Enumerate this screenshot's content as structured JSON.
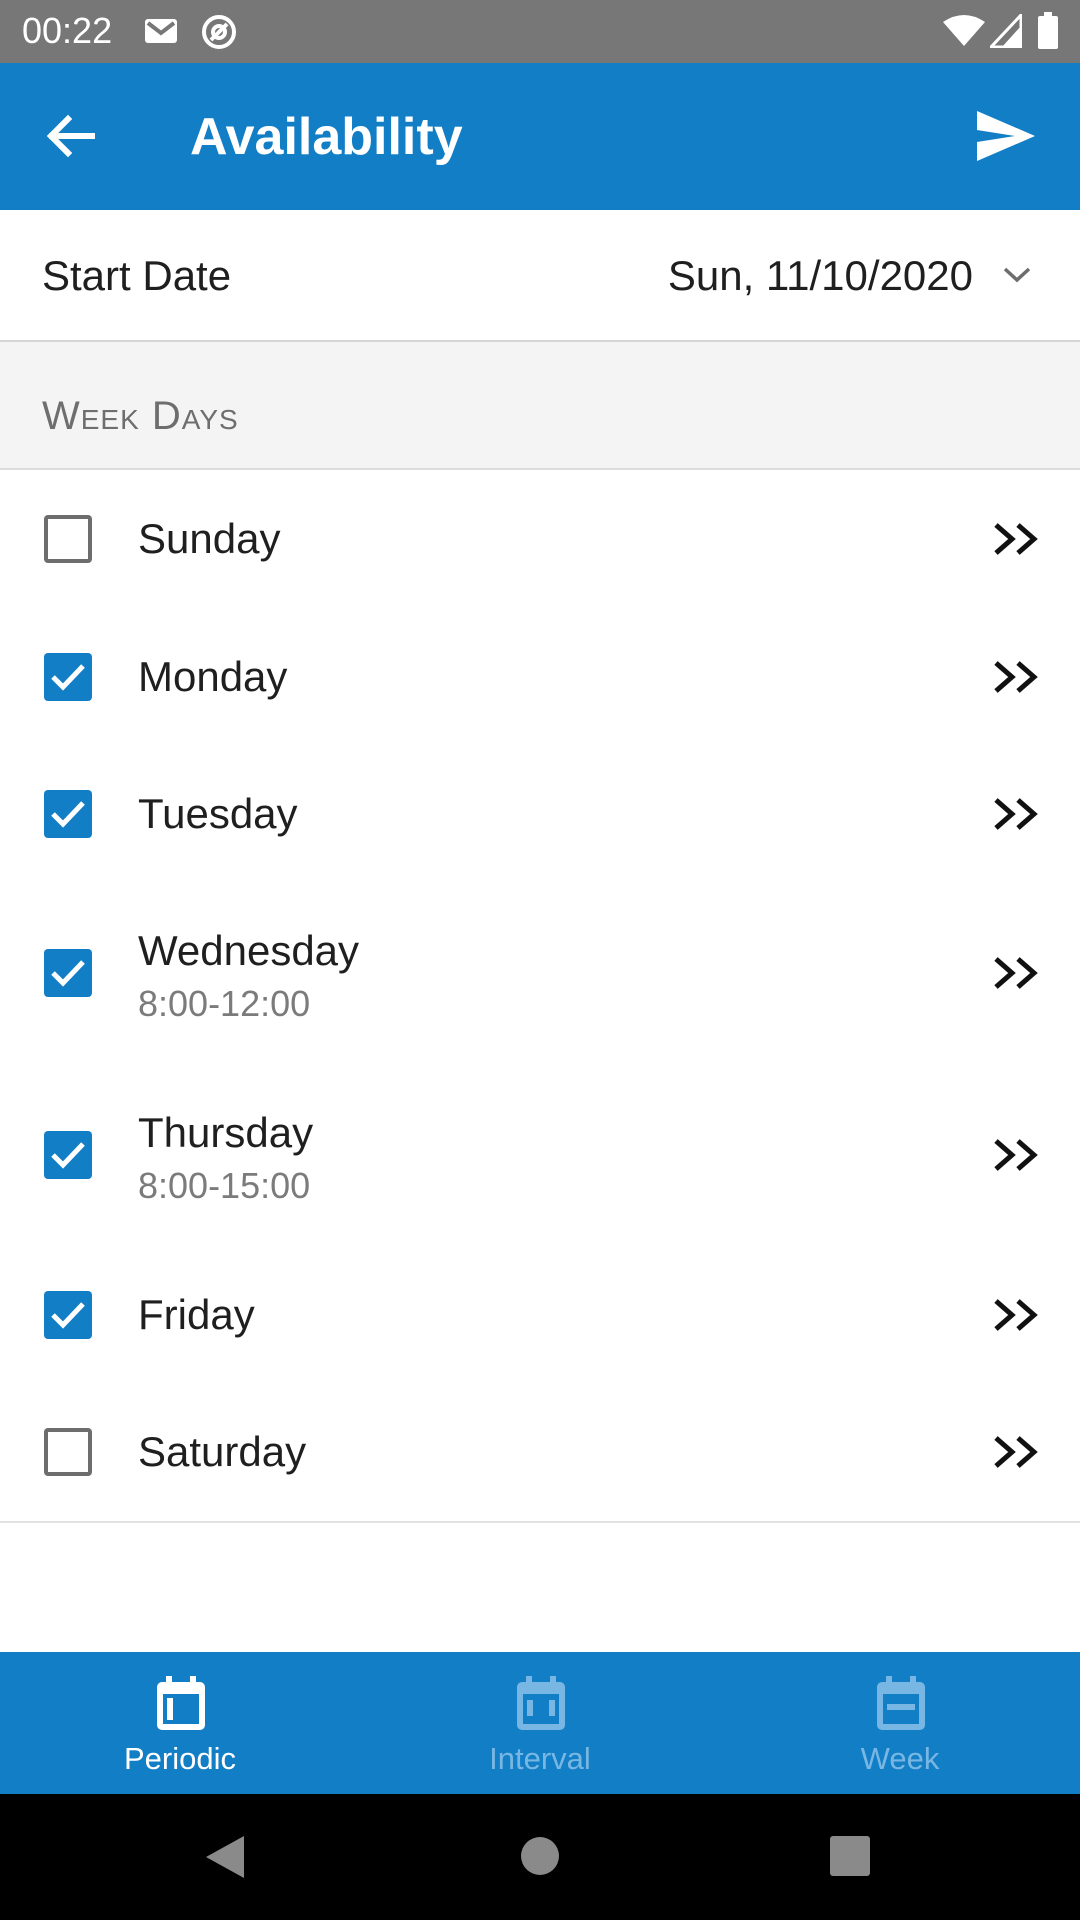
{
  "status_bar": {
    "time": "00:22",
    "left_icons": [
      "gmail-icon",
      "at-sign-icon"
    ],
    "right_icons": [
      "wifi-icon",
      "signal-icon",
      "battery-icon"
    ]
  },
  "app_bar": {
    "title": "Availability",
    "back_icon": "arrow-left-icon",
    "send_icon": "send-icon",
    "color": "#127ec6"
  },
  "start_date": {
    "label": "Start Date",
    "value": "Sun, 11/10/2020",
    "icon": "chevron-down-icon"
  },
  "week_days": {
    "header": "Week Days",
    "days": [
      {
        "name": "Sunday",
        "checked": false,
        "time": ""
      },
      {
        "name": "Monday",
        "checked": true,
        "time": ""
      },
      {
        "name": "Tuesday",
        "checked": true,
        "time": ""
      },
      {
        "name": "Wednesday",
        "checked": true,
        "time": "8:00-12:00"
      },
      {
        "name": "Thursday",
        "checked": true,
        "time": "8:00-15:00"
      },
      {
        "name": "Friday",
        "checked": true,
        "time": ""
      },
      {
        "name": "Saturday",
        "checked": false,
        "time": ""
      }
    ]
  },
  "bottom_nav": {
    "items": [
      {
        "label": "Periodic",
        "icon": "calendar-icon",
        "active": true
      },
      {
        "label": "Interval",
        "icon": "calendar-range-icon",
        "active": false
      },
      {
        "label": "Week",
        "icon": "calendar-week-icon",
        "active": false
      }
    ]
  },
  "system_nav": [
    "back-triangle-icon",
    "home-circle-icon",
    "recents-square-icon"
  ]
}
